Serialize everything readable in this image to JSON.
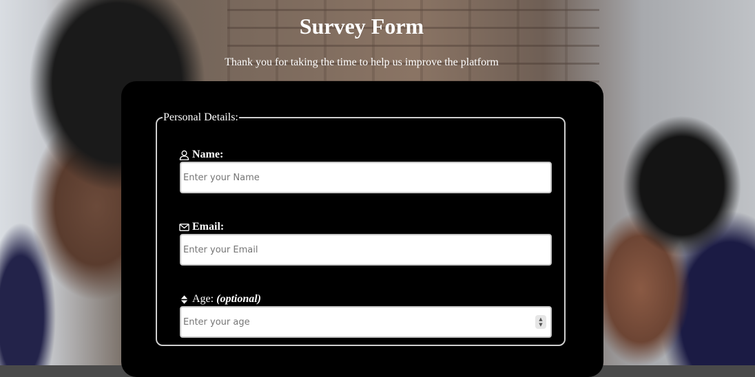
{
  "header": {
    "title": "Survey Form",
    "subtitle": "Thank you for taking the time to help us improve the platform"
  },
  "form": {
    "personal_details": {
      "legend": "Personal Details:",
      "name": {
        "label": "Name:",
        "icon": "user-icon",
        "placeholder": "Enter your Name",
        "value": ""
      },
      "email": {
        "label": "Email:",
        "icon": "envelope-icon",
        "placeholder": "Enter your Email",
        "value": ""
      },
      "age": {
        "label": "Age:",
        "optional_note": "(optional)",
        "icon": "sort-icon",
        "placeholder": "Enter your age",
        "value": ""
      }
    }
  },
  "colors": {
    "card_background": "#000000",
    "text": "#ffffff",
    "fieldset_border": "#cfcfcf",
    "input_background": "#ffffff"
  }
}
